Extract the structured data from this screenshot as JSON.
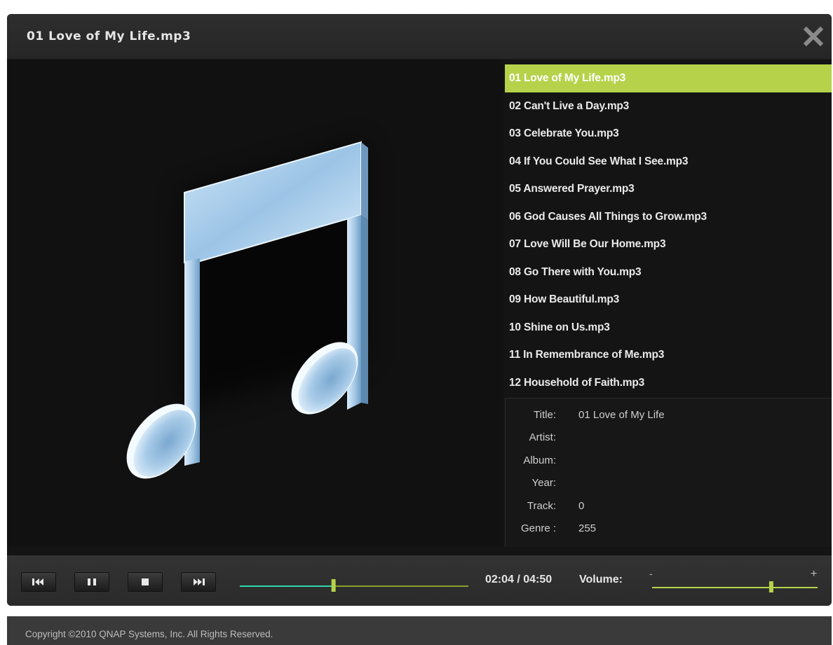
{
  "window": {
    "title": "01 Love of My Life.mp3",
    "close_icon": "close-icon"
  },
  "album_art": {
    "icon": "music-note-icon"
  },
  "playlist": {
    "active_index": 0,
    "active_color": "#b5d24a",
    "items": [
      "01 Love of My Life.mp3",
      "02 Can't Live a Day.mp3",
      "03 Celebrate You.mp3",
      "04 If You Could See What I See.mp3",
      "05 Answered Prayer.mp3",
      "06 God Causes All Things to Grow.mp3",
      "07 Love Will Be Our Home.mp3",
      "08 Go There with You.mp3",
      "09 How Beautiful.mp3",
      "10 Shine on Us.mp3",
      "11 In Remembrance of Me.mp3",
      "12 Household of Faith.mp3"
    ]
  },
  "info": {
    "title_label": "Title:",
    "title_value": "01 Love of My Life",
    "artist_label": "Artist:",
    "artist_value": "",
    "album_label": "Album:",
    "album_value": "",
    "year_label": "Year:",
    "year_value": "",
    "track_label": "Track:",
    "track_value": "0",
    "genre_label": "Genre :",
    "genre_value": "255"
  },
  "controls": {
    "previous_icon": "skip-previous-icon",
    "pause_icon": "pause-icon",
    "stop_icon": "stop-icon",
    "next_icon": "skip-next-icon",
    "time": "02:04 / 04:50",
    "progress_fraction": 0.41,
    "volume_label": "Volume:",
    "volume_min_label": "-",
    "volume_max_label": "+",
    "volume_fraction": 0.72,
    "accent_color": "#b5d24a",
    "played_color": "#2ed6b0"
  },
  "footer": {
    "copyright": "Copyright ©2010 QNAP Systems, Inc. All Rights Reserved."
  }
}
